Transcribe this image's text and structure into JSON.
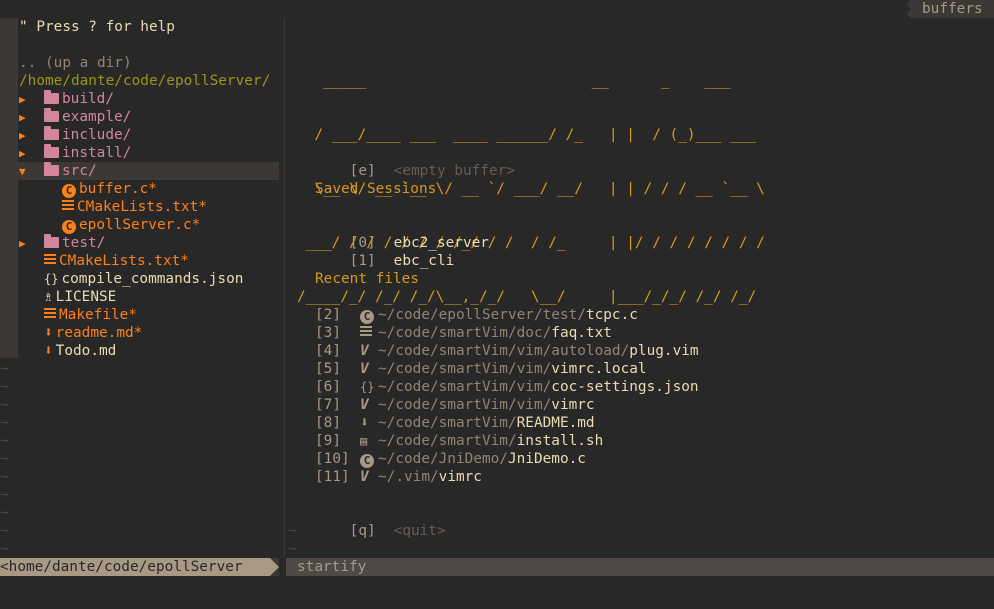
{
  "tabline": {
    "buffers_label": "buffers"
  },
  "tree": {
    "help": "\" Press ? for help",
    "up_dir": ".. (up a dir)",
    "root": "/home/dante/code/epollServer/",
    "items": [
      {
        "label": "build/",
        "kind": "folder",
        "expanded": false
      },
      {
        "label": "example/",
        "kind": "folder",
        "expanded": false
      },
      {
        "label": "include/",
        "kind": "folder",
        "expanded": false
      },
      {
        "label": "install/",
        "kind": "folder",
        "expanded": false
      },
      {
        "label": "src/",
        "kind": "folder",
        "expanded": true
      },
      {
        "label": "buffer.c*",
        "kind": "c-file"
      },
      {
        "label": "CMakeLists.txt*",
        "kind": "txt-file"
      },
      {
        "label": "epollServer.c*",
        "kind": "c-file"
      },
      {
        "label": "test/",
        "kind": "folder",
        "expanded": false
      },
      {
        "label": "CMakeLists.txt*",
        "kind": "txt-file"
      },
      {
        "label": "compile_commands.json",
        "kind": "json-file"
      },
      {
        "label": "LICENSE",
        "kind": "license-file"
      },
      {
        "label": "Makefile*",
        "kind": "txt-file"
      },
      {
        "label": "readme.md*",
        "kind": "md-file"
      },
      {
        "label": "Todo.md",
        "kind": "md-file"
      }
    ]
  },
  "startify": {
    "banner": [
      "   _____                          __      _    ___",
      "  / ___/____ ___  ____ ______/ /_   | |  / (_)___ ___",
      "  \\__ \\/ __ `__ \\/ __ `/ ___/ __/   | | / / / __ `__ \\",
      " ___/ / / / / / / /_/ / /  / /_     | |/ / / / / / / /",
      "/____/_/ /_/ /_/\\__,_/_/   \\__/     |___/_/_/ /_/ /_/"
    ],
    "empty_key": "[e]",
    "empty_label": "<empty buffer>",
    "sessions_header": "Saved Sessions",
    "sessions": [
      {
        "key": "[0]",
        "name": "ebc2_server"
      },
      {
        "key": "[1]",
        "name": "ebc_cli"
      }
    ],
    "recent_header": "Recent files",
    "recent": [
      {
        "key": "[2]",
        "icon": "c-file-icon",
        "dir": "~/code/epollServer/test/",
        "file": "tcpc.c"
      },
      {
        "key": "[3]",
        "icon": "text-file-icon",
        "dir": "~/code/smartVim/doc/",
        "file": "faq.txt"
      },
      {
        "key": "[4]",
        "icon": "vim-icon",
        "dir": "~/code/smartVim/vim/autoload/",
        "file": "plug.vim"
      },
      {
        "key": "[5]",
        "icon": "vim-icon",
        "dir": "~/code/smartVim/vim/",
        "file": "vimrc.local"
      },
      {
        "key": "[6]",
        "icon": "json-icon",
        "dir": "~/code/smartVim/vim/",
        "file": "coc-settings.json"
      },
      {
        "key": "[7]",
        "icon": "vim-icon",
        "dir": "~/code/smartVim/vim/",
        "file": "vimrc"
      },
      {
        "key": "[8]",
        "icon": "markdown-icon",
        "dir": "~/code/smartVim/",
        "file": "README.md"
      },
      {
        "key": "[9]",
        "icon": "shell-icon",
        "dir": "~/code/smartVim/",
        "file": "install.sh"
      },
      {
        "key": "[10]",
        "icon": "c-file-icon",
        "dir": "~/code/JniDemo/",
        "file": "JniDemo.c"
      },
      {
        "key": "[11]",
        "icon": "vim-icon",
        "dir": "~/.vim/",
        "file": "vimrc"
      }
    ],
    "quit_key": "[q]",
    "quit_label": "<quit>"
  },
  "statusline": {
    "left": "<home/dante/code/epollServer",
    "right": "startify"
  },
  "colors": {
    "background": "#282828",
    "accent_yellow": "#d79921",
    "accent_orange": "#fe8019",
    "folder_pink": "#d3869b",
    "path_olive": "#98971a"
  }
}
